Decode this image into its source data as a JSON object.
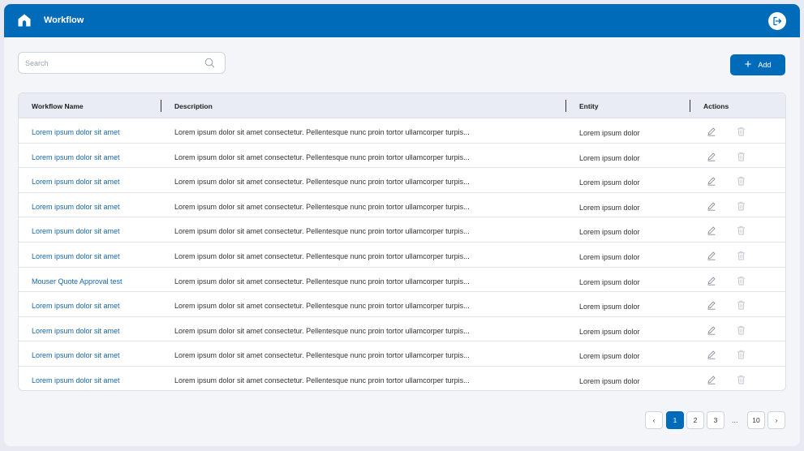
{
  "header": {
    "title": "Workflow",
    "home_icon": "home-icon",
    "logout_icon": "logout-icon"
  },
  "search": {
    "placeholder": "Search",
    "value": ""
  },
  "toolbar": {
    "add_label": "Add"
  },
  "table": {
    "columns": [
      "Workflow Name",
      "Description",
      "Entity",
      "Actions"
    ],
    "rows": [
      {
        "name": "Lorem ipsum dolor sit amet",
        "description": "Lorem ipsum dolor sit amet consectetur. Pellentesque nunc proin tortor ullamcorper turpis...",
        "entity": "Lorem ipsum dolor"
      },
      {
        "name": "Lorem ipsum dolor sit amet",
        "description": "Lorem ipsum dolor sit amet consectetur. Pellentesque nunc proin tortor ullamcorper turpis...",
        "entity": "Lorem ipsum dolor"
      },
      {
        "name": "Lorem ipsum dolor sit amet",
        "description": "Lorem ipsum dolor sit amet consectetur. Pellentesque nunc proin tortor ullamcorper turpis...",
        "entity": "Lorem ipsum dolor"
      },
      {
        "name": "Lorem ipsum dolor sit amet",
        "description": "Lorem ipsum dolor sit amet consectetur. Pellentesque nunc proin tortor ullamcorper turpis...",
        "entity": "Lorem ipsum dolor"
      },
      {
        "name": "Lorem ipsum dolor sit amet",
        "description": "Lorem ipsum dolor sit amet consectetur. Pellentesque nunc proin tortor ullamcorper turpis...",
        "entity": "Lorem ipsum dolor"
      },
      {
        "name": "Lorem ipsum dolor sit amet",
        "description": "Lorem ipsum dolor sit amet consectetur. Pellentesque nunc proin tortor ullamcorper turpis...",
        "entity": "Lorem ipsum dolor"
      },
      {
        "name": "Mouser Quote Approval test",
        "description": "Lorem ipsum dolor sit amet consectetur. Pellentesque nunc proin tortor ullamcorper turpis...",
        "entity": "Lorem ipsum dolor"
      },
      {
        "name": "Lorem ipsum dolor sit amet",
        "description": "Lorem ipsum dolor sit amet consectetur. Pellentesque nunc proin tortor ullamcorper turpis...",
        "entity": "Lorem ipsum dolor"
      },
      {
        "name": "Lorem ipsum dolor sit amet",
        "description": "Lorem ipsum dolor sit amet consectetur. Pellentesque nunc proin tortor ullamcorper turpis...",
        "entity": "Lorem ipsum dolor"
      },
      {
        "name": "Lorem ipsum dolor sit amet",
        "description": "Lorem ipsum dolor sit amet consectetur. Pellentesque nunc proin tortor ullamcorper turpis...",
        "entity": "Lorem ipsum dolor"
      },
      {
        "name": "Lorem ipsum dolor sit amet",
        "description": "Lorem ipsum dolor sit amet consectetur. Pellentesque nunc proin tortor ullamcorper turpis...",
        "entity": "Lorem ipsum dolor"
      }
    ],
    "row_action_icons": [
      "edit-icon",
      "trash-icon"
    ]
  },
  "pagination": {
    "prev": "‹",
    "pages": [
      "1",
      "2",
      "3"
    ],
    "ellipsis": "...",
    "last": "10",
    "next": "›",
    "current": "1"
  },
  "colors": {
    "accent": "#006bb8",
    "link": "#1766a8",
    "header_bg": "#eaecf5"
  }
}
